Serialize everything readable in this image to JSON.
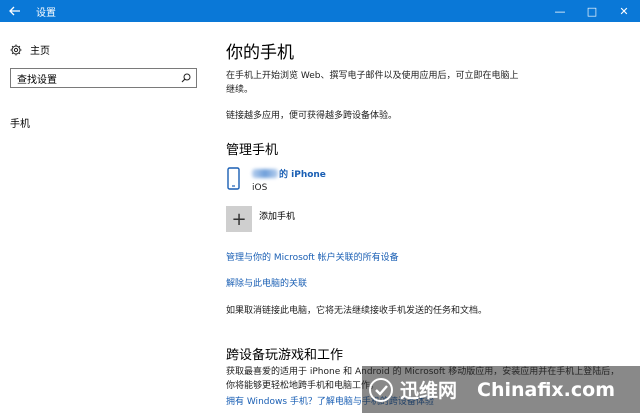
{
  "window": {
    "title": "设置",
    "controls": [
      "—",
      "□",
      "✕"
    ]
  },
  "sidebar": {
    "home_label": "主页",
    "search_placeholder": "查找设置",
    "items": [
      {
        "label": "手机"
      }
    ]
  },
  "main": {
    "title": "你的手机",
    "description": "在手机上开始浏览 Web、撰写电子邮件以及使用应用后，可立即在电脑上继续。",
    "description2": "链接越多应用，便可获得越多跨设备体验。",
    "manage_heading": "管理手机",
    "device": {
      "name_suffix": "的 iPhone",
      "os": "iOS"
    },
    "add_phone_label": "添加手机",
    "link_manage_all": "管理与你的 Microsoft 帐户关联的所有设备",
    "link_unlink": "解除与此电脑的关联",
    "unlink_note": "如果取消链接此电脑，它将无法继续接收手机发送的任务和文档。",
    "cross_device_heading": "跨设备玩游戏和工作",
    "cross_device_text": "获取最喜爱的适用于 iPhone 和 Android 的 Microsoft 移动版应用，安装应用并在手机上登陆后，你将能够更轻松地跨手机和电脑工作。",
    "link_windows_phone": "拥有 Windows 手机？了解电脑与手机的跨设备体验"
  },
  "watermark": {
    "cn": "迅维网",
    "en": "Chinafix.com"
  },
  "colors": {
    "accent": "#0a78d7",
    "link": "#1a5fb4"
  }
}
